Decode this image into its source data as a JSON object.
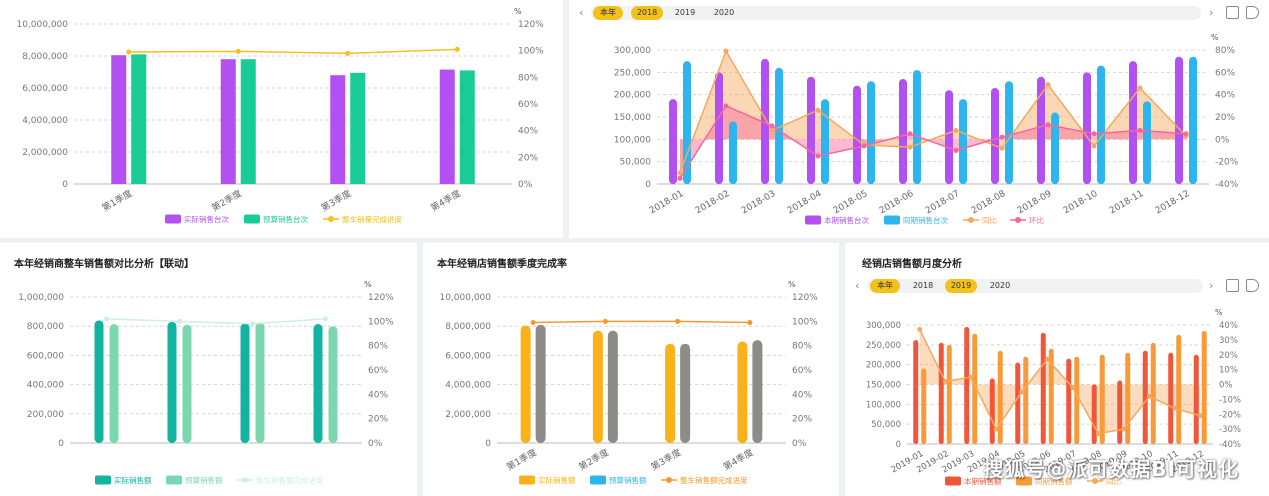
{
  "year_tabs": [
    "本年",
    "2018",
    "2019",
    "2020"
  ],
  "watermark": "搜狐号@派可数据BI可视化",
  "colors": {
    "purple": "#b250f2",
    "green": "#19cc95",
    "gold": "#f3c01e",
    "blue": "#2db5f0",
    "teal": "#13b3a1",
    "mint": "#7ad7ae",
    "orange_band": "#f6a85c",
    "pink": "#f7679b",
    "red": "#f0563a",
    "orange": "#f99a38",
    "yellow": "#fbb11a",
    "gray": "#8c8c88"
  },
  "panels": {
    "p1": {
      "title": "",
      "legend": [
        "实际销售台次",
        "预算销售台次",
        "整车销量完成进度"
      ],
      "chart_data": {
        "type": "bar",
        "categories": [
          "第1季度",
          "第2季度",
          "第3季度",
          "第4季度"
        ],
        "series": [
          {
            "name": "实际销售台次",
            "type": "bar",
            "values": [
              8050000,
              7800000,
              6800000,
              7150000
            ]
          },
          {
            "name": "预算销售台次",
            "type": "bar",
            "values": [
              8100000,
              7800000,
              6950000,
              7100000
            ]
          },
          {
            "name": "整车销量完成进度",
            "type": "line",
            "axis": "right",
            "values": [
              99,
              99.5,
              98,
              101
            ]
          }
        ],
        "ylim": [
          0,
          10000000
        ],
        "y2lim": [
          0,
          120
        ],
        "y2label": "%",
        "yticks": [
          "0",
          "2,000,000",
          "4,000,000",
          "6,000,000",
          "8,000,000",
          "10,000,000"
        ],
        "y2ticks": [
          "0%",
          "20%",
          "40%",
          "60%",
          "80%",
          "100%",
          "120%"
        ]
      }
    },
    "p2": {
      "title": "",
      "selected_year": "2018",
      "legend": [
        "本期销售台次",
        "同期销售台次",
        "同比",
        "环比"
      ],
      "chart_data": {
        "type": "bar",
        "categories": [
          "2018-01",
          "2018-02",
          "2018-03",
          "2018-04",
          "2018-05",
          "2018-06",
          "2018-07",
          "2018-08",
          "2018-09",
          "2018-10",
          "2018-11",
          "2018-12"
        ],
        "series": [
          {
            "name": "本期销售台次",
            "type": "bar",
            "values": [
              190000,
              250000,
              280000,
              240000,
              220000,
              235000,
              210000,
              215000,
              240000,
              250000,
              275000,
              285000
            ]
          },
          {
            "name": "同期销售台次",
            "type": "bar",
            "values": [
              275000,
              140000,
              260000,
              190000,
              230000,
              255000,
              190000,
              230000,
              160000,
              265000,
              185000,
              285000
            ]
          },
          {
            "name": "同比",
            "type": "area",
            "axis": "right",
            "values": [
              -30,
              79,
              8,
              26,
              -5,
              -7,
              8,
              -8,
              49,
              -6,
              46,
              3
            ]
          },
          {
            "name": "环比",
            "type": "area",
            "axis": "right",
            "values": [
              -35,
              30,
              12,
              -15,
              -6,
              5,
              -10,
              2,
              13,
              5,
              8,
              5
            ]
          }
        ],
        "ylim": [
          0,
          300000
        ],
        "y2lim": [
          -40,
          80
        ],
        "y2label": "%",
        "yticks": [
          "0",
          "50,000",
          "100,000",
          "150,000",
          "200,000",
          "250,000",
          "300,000"
        ],
        "y2ticks": [
          "-40%",
          "-20%",
          "0%",
          "20%",
          "40%",
          "60%",
          "80%"
        ]
      }
    },
    "p3": {
      "title": "本年经销商整车销售额对比分析【联动】",
      "legend": [
        "实际销售额",
        "预算销售额",
        "整车销售额完成进度"
      ],
      "chart_data": {
        "type": "bar",
        "categories": [
          "",
          "",
          "",
          ""
        ],
        "series": [
          {
            "name": "实际销售额",
            "type": "bar",
            "values": [
              840000,
              830000,
              820000,
              815000
            ]
          },
          {
            "name": "预算销售额",
            "type": "bar",
            "values": [
              815000,
              810000,
              825000,
              800000
            ]
          },
          {
            "name": "整车销售额完成进度",
            "type": "line",
            "axis": "right",
            "values": [
              102,
              100,
              98,
              102
            ]
          }
        ],
        "ylim": [
          0,
          1000000
        ],
        "y2lim": [
          0,
          120
        ],
        "y2label": "%",
        "yticks": [
          "0",
          "200,000",
          "400,000",
          "600,000",
          "800,000",
          "1,000,000"
        ],
        "y2ticks": [
          "0%",
          "20%",
          "40%",
          "60%",
          "80%",
          "100%",
          "120%"
        ]
      }
    },
    "p4": {
      "title": "本年经销店销售额季度完成率",
      "legend": [
        "实际销售额",
        "预算销售额",
        "整车销售额完成进度"
      ],
      "chart_data": {
        "type": "bar",
        "categories": [
          "第1季度",
          "第2季度",
          "第3季度",
          "第4季度"
        ],
        "series": [
          {
            "name": "实际销售额",
            "type": "bar",
            "values": [
              8050000,
              7700000,
              6800000,
              6950000
            ]
          },
          {
            "name": "预算销售额",
            "type": "bar",
            "values": [
              8100000,
              7700000,
              6800000,
              7050000
            ]
          },
          {
            "name": "整车销售额完成进度",
            "type": "line",
            "axis": "right",
            "values": [
              99,
              100,
              100,
              99
            ]
          }
        ],
        "ylim": [
          0,
          10000000
        ],
        "y2lim": [
          0,
          120
        ],
        "y2label": "%",
        "yticks": [
          "0",
          "2,000,000",
          "4,000,000",
          "6,000,000",
          "8,000,000",
          "10,000,000"
        ],
        "y2ticks": [
          "0%",
          "20%",
          "40%",
          "60%",
          "80%",
          "100%",
          "120%"
        ]
      }
    },
    "p5": {
      "title": "经销店销售额月度分析",
      "selected_year": "2019",
      "legend": [
        "本期销售额",
        "同期销售额",
        "同比"
      ],
      "chart_data": {
        "type": "bar",
        "categories": [
          "2019-01",
          "2019-02",
          "2019-03",
          "2019-04",
          "2019-05",
          "2019-06",
          "2019-07",
          "2019-08",
          "2019-09",
          "2019-10",
          "2019-11",
          "2019-12"
        ],
        "series": [
          {
            "name": "本期销售额",
            "type": "bar",
            "values": [
              262000,
              255000,
              295000,
              165000,
              205000,
              280000,
              215000,
              150000,
              160000,
              235000,
              230000,
              225000
            ]
          },
          {
            "name": "同期销售额",
            "type": "bar",
            "values": [
              190000,
              250000,
              278000,
              235000,
              220000,
              240000,
              220000,
              225000,
              230000,
              255000,
              275000,
              285000
            ]
          },
          {
            "name": "同比",
            "type": "area",
            "axis": "right",
            "values": [
              37,
              2,
              5,
              -30,
              -5,
              17,
              -2,
              -33,
              -30,
              -8,
              -16,
              -21
            ]
          }
        ],
        "ylim": [
          0,
          300000
        ],
        "y2lim": [
          -40,
          40
        ],
        "y2label": "%",
        "yticks": [
          "0",
          "50,000",
          "100,000",
          "150,000",
          "200,000",
          "250,000",
          "300,000"
        ],
        "y2ticks": [
          "-40%",
          "-30%",
          "-20%",
          "-10%",
          "0%",
          "10%",
          "20%",
          "30%",
          "40%"
        ]
      }
    }
  }
}
